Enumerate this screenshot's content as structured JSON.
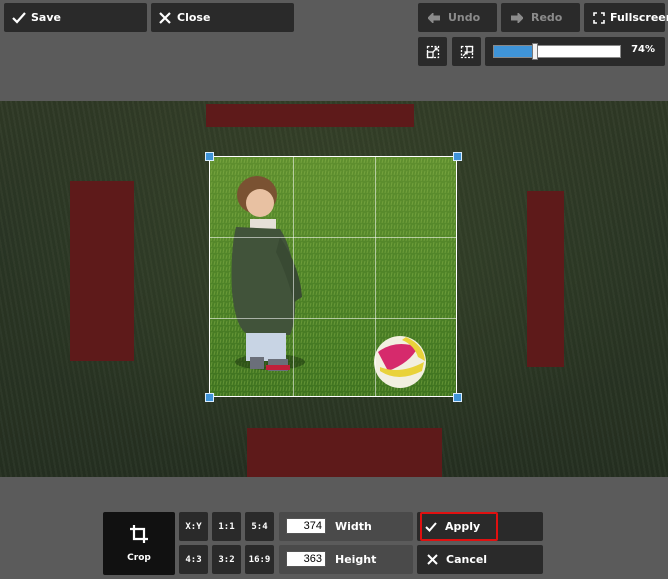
{
  "toolbar": {
    "save_label": "Save",
    "close_label": "Close",
    "undo_label": "Undo",
    "redo_label": "Redo",
    "fullscreen_label": "Fullscreen"
  },
  "zoom": {
    "value_label": "74%",
    "value": 0.74
  },
  "crop": {
    "tool_label": "Crop",
    "ratios": [
      "X:Y",
      "1:1",
      "5:4",
      "4:3",
      "3:2",
      "16:9"
    ],
    "width_label": "Width",
    "width_value": "374",
    "height_label": "Height",
    "height_value": "363",
    "apply_label": "Apply",
    "cancel_label": "Cancel"
  },
  "colors": {
    "accent": "#3f94d8",
    "marker": "#5e1a1a",
    "highlight": "#e01010",
    "button_bg": "#2a2a2a",
    "background": "#5b5b5b"
  },
  "icons": [
    "check-icon",
    "close-icon",
    "undo-arrow-icon",
    "redo-arrow-icon",
    "fullscreen-icon",
    "zoom-out-icon",
    "zoom-in-icon",
    "crop-icon"
  ]
}
